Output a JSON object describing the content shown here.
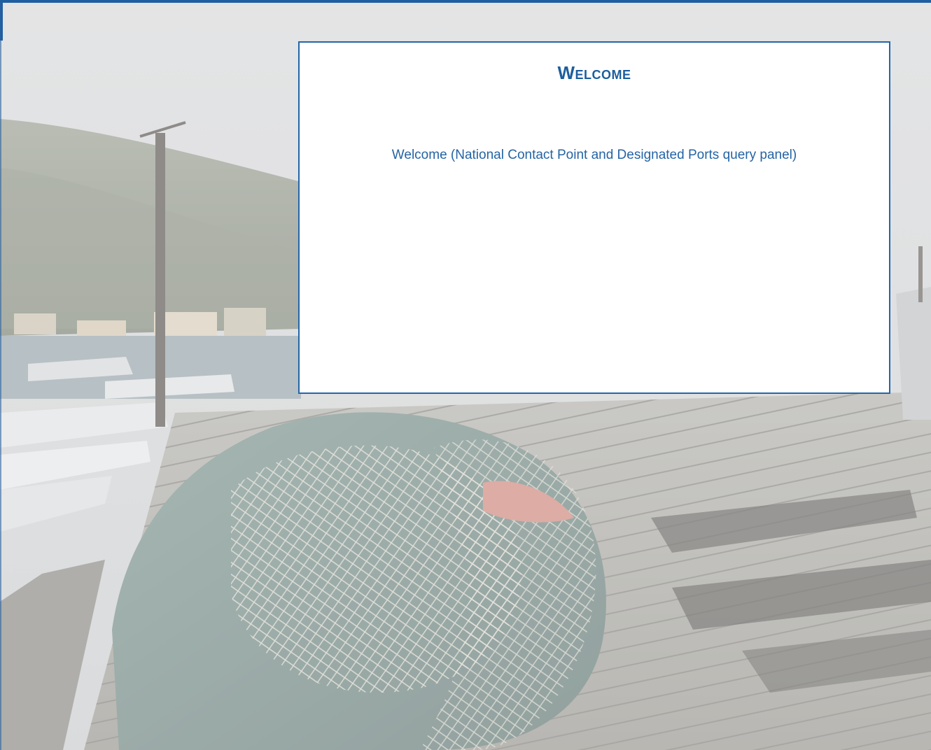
{
  "welcome": {
    "title": "Welcome",
    "message": "Welcome (National Contact Point and Designated Ports query panel)"
  },
  "colors": {
    "accent": "#1f5fa0",
    "title_text": "#1d5e9e",
    "panel_border": "#2366a8",
    "panel_background": "#ffffff"
  },
  "background": {
    "scene": "harbour-fishing-nets-photo"
  }
}
